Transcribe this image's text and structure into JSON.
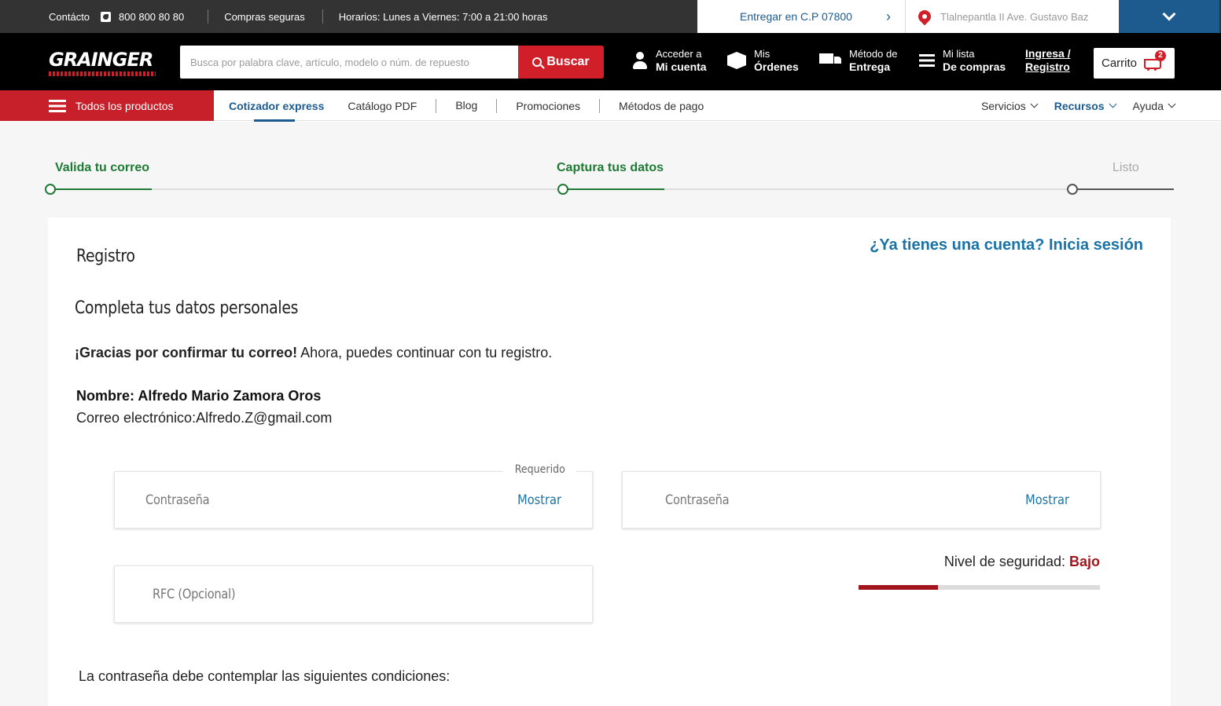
{
  "topbar": {
    "contact_label": "Contácto",
    "phone": "800 800 80 80",
    "secure": "Compras seguras",
    "hours": "Horarios: Lunes a Viernes: 7:00 a 21:00 horas",
    "deliver": "Entregar en C.P 07800",
    "deliver_arrow": "›",
    "location": "Tlalnepantla II  Ave. Gustavo Baz"
  },
  "header": {
    "logo": "GRAINGER",
    "search_placeholder": "Busca por palabra clave, artículo, modelo o núm. de repuesto",
    "search_button": "Buscar",
    "account_l1": "Acceder a",
    "account_l2": "Mi cuenta",
    "orders_l1": "Mis",
    "orders_l2": "Órdenes",
    "delivery_l1": "Método de",
    "delivery_l2": "Entrega",
    "list_l1": "Mi lista",
    "list_l2": "De compras",
    "login_l1": "Ingresa /",
    "login_l2": "Registro",
    "cart_label": "Carrito",
    "cart_count": "2"
  },
  "nav": {
    "all_products": "Todos los productos",
    "links": [
      "Cotizador express",
      "Catálogo PDF",
      "Blog",
      "Promociones",
      "Métodos de pago"
    ],
    "right": [
      "Servicios",
      "Recursos",
      "Ayuda"
    ]
  },
  "stepper": {
    "steps": [
      "Valida tu correo",
      "Captura tus datos",
      "Listo"
    ]
  },
  "card": {
    "title": "Registro",
    "signin": "¿Ya tienes una cuenta? Inicia sesión",
    "subtitle": "Completa tus datos personales",
    "thanks_bold": "¡Gracias por confirmar tu correo!",
    "thanks_rest": " Ahora, puedes continuar con tu registro.",
    "name": "Nombre: Alfredo Mario Zamora Oros",
    "email": "Correo electrónico:Alfredo.Z@gmail.com",
    "password_placeholder": "Contraseña",
    "required": "Requerido",
    "show": "Mostrar",
    "password_confirm_placeholder": "Contraseña",
    "rfc_placeholder": "RFC (Opcional)",
    "security_label": "Nivel de seguridad: ",
    "security_level": "Bajo",
    "security_fraction": 0.33,
    "conditions": "La contraseña debe contemplar las siguientes condiciones:"
  },
  "colors": {
    "brand_red": "#d11f2a",
    "brand_blue": "#1d5b8f",
    "success_green": "#1f7a35",
    "weak_red": "#a3151d"
  }
}
